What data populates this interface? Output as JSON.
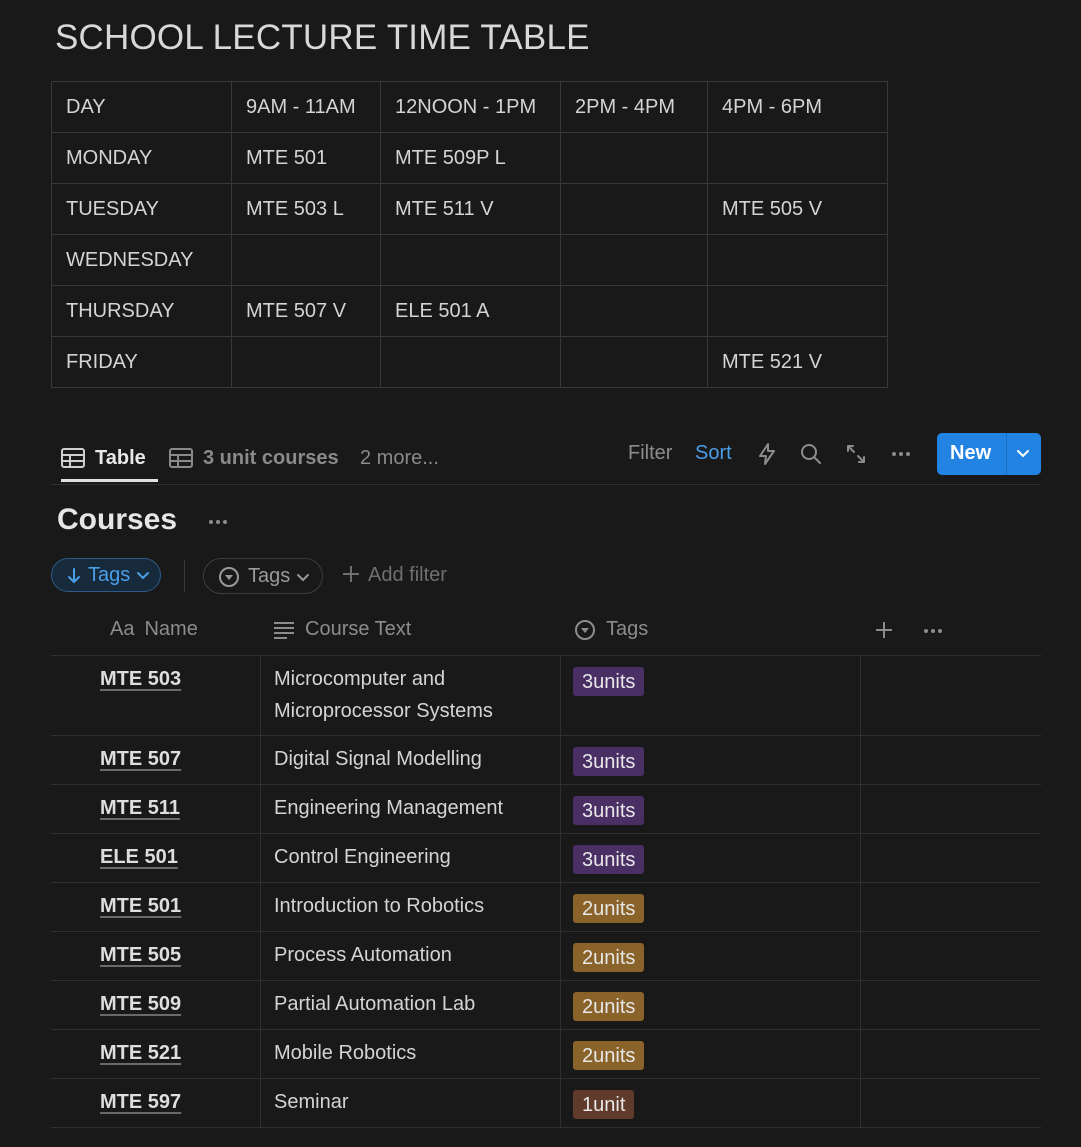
{
  "page": {
    "title": "SCHOOL LECTURE TIME TABLE"
  },
  "timetable": {
    "header": [
      "DAY",
      "9AM - 11AM",
      "12NOON - 1PM",
      "2PM - 4PM",
      "4PM - 6PM"
    ],
    "rows": [
      [
        "MONDAY",
        "MTE 501",
        "MTE 509P L",
        "",
        ""
      ],
      [
        "TUESDAY",
        "MTE 503 L",
        "MTE 511 V",
        "",
        "MTE 505 V"
      ],
      [
        "WEDNESDAY",
        "",
        "",
        "",
        ""
      ],
      [
        "THURSDAY",
        "MTE 507 V",
        "ELE 501 A",
        "",
        ""
      ],
      [
        "FRIDAY",
        "",
        "",
        "",
        "MTE 521 V"
      ]
    ]
  },
  "views": {
    "tabs": [
      {
        "label": "Table",
        "icon": "table-icon",
        "active": true
      },
      {
        "label": "3 unit courses",
        "icon": "table-icon",
        "active": false
      }
    ],
    "more_label": "2 more...",
    "filter_label": "Filter",
    "sort_label": "Sort",
    "new_label": "New"
  },
  "database": {
    "title": "Courses",
    "sort_chip_label": "Tags",
    "filter_chip_label": "Tags",
    "add_filter_label": "Add filter",
    "columns": {
      "name": "Name",
      "name_icon": "Aa",
      "text": "Course Text",
      "tags": "Tags"
    },
    "rows": [
      {
        "name": "MTE 503",
        "text": "Microcomputer and Microprocessor Systems",
        "tag": "3units",
        "tag_color": "#492f64"
      },
      {
        "name": "MTE 507",
        "text": "Digital Signal Modelling",
        "tag": "3units",
        "tag_color": "#492f64"
      },
      {
        "name": "MTE 511",
        "text": "Engineering Management",
        "tag": "3units",
        "tag_color": "#492f64"
      },
      {
        "name": "ELE 501",
        "text": "Control Engineering",
        "tag": "3units",
        "tag_color": "#492f64"
      },
      {
        "name": "MTE 501",
        "text": "Introduction to Robotics",
        "tag": "2units",
        "tag_color": "#89632a"
      },
      {
        "name": "MTE 505",
        "text": "Process Automation",
        "tag": "2units",
        "tag_color": "#89632a"
      },
      {
        "name": "MTE 509",
        "text": "Partial Automation Lab",
        "tag": "2units",
        "tag_color": "#89632a"
      },
      {
        "name": "MTE 521",
        "text": "Mobile Robotics",
        "tag": "2units",
        "tag_color": "#89632a"
      },
      {
        "name": "MTE 597",
        "text": "Seminar",
        "tag": "1unit",
        "tag_color": "#603b2c"
      }
    ]
  },
  "colors": {
    "background": "#191919",
    "accent": "#2383e2",
    "sort_text": "#4a9ee8"
  }
}
